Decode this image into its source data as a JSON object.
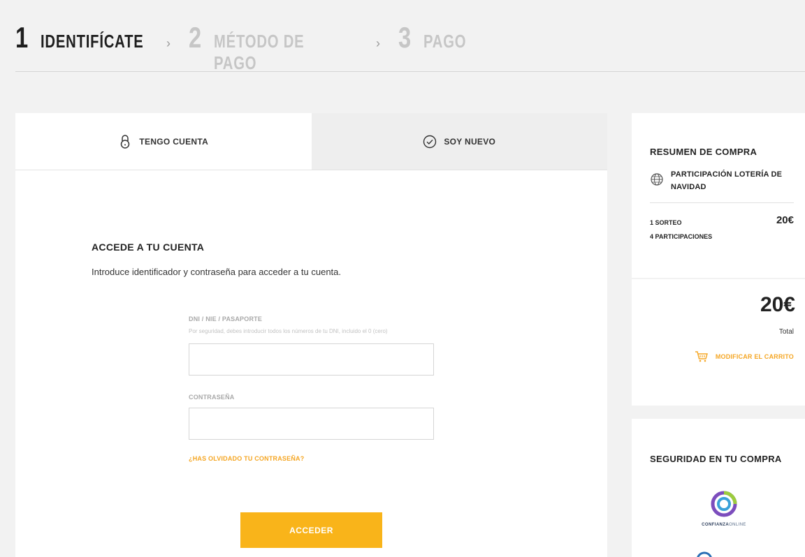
{
  "steps": [
    {
      "num": "1",
      "label": "IDENTIFÍCATE",
      "state": "active"
    },
    {
      "num": "2",
      "label": "MÉTODO DE PAGO",
      "state": "inactive"
    },
    {
      "num": "3",
      "label": "PAGO",
      "state": "inactive"
    }
  ],
  "step_separator": "›",
  "tabs": {
    "have_account": "TENGO CUENTA",
    "new_user": "SOY NUEVO"
  },
  "login": {
    "title": "ACCEDE A TU CUENTA",
    "description": "Introduce identificador y contraseña para acceder a tu cuenta.",
    "id_label": "DNI / NIE / PASAPORTE",
    "id_hint": "Por seguridad, debes introducir todos los números de tu DNI, incluido el 0 (cero)",
    "id_value": "",
    "password_label": "CONTRASEÑA",
    "password_value": "",
    "forgot": "¿HAS OLVIDADO TU CONTRASEÑA?",
    "submit": "ACCEDER"
  },
  "summary": {
    "title": "RESUMEN DE COMPRA",
    "product": "PARTICIPACIÓN LOTERÍA DE NAVIDAD",
    "draws": "1 SORTEO",
    "draws_price": "20€",
    "participations": "4 PARTICIPACIONES",
    "total_amount": "20€",
    "total_label": "Total",
    "modify_cart": "MODIFICAR EL CARRITO"
  },
  "security": {
    "title": "SEGURIDAD EN TU COMPRA",
    "seal_caption_bold": "CONFIANZA",
    "seal_caption_light": "ONLINE"
  },
  "colors": {
    "accent": "#f9b41a",
    "link": "#f5a623",
    "background": "#f2f2f2"
  }
}
